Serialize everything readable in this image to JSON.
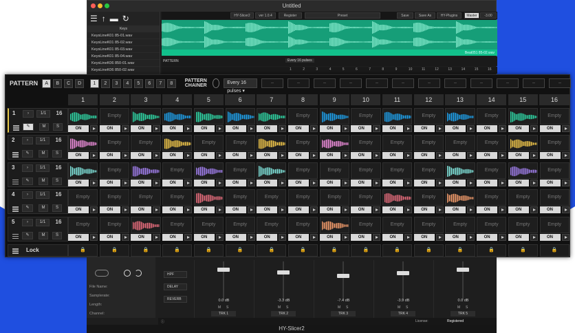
{
  "window": {
    "title": "Untitled",
    "app_name": "HY-Slicer2"
  },
  "topbar": {
    "plugin": "HY-Slicer2",
    "version": "ver 1.0.4",
    "register": "Register",
    "preset": "Preset",
    "save": "Save",
    "save_as": "Save As",
    "plugins": "HY-Plugins",
    "master": "Master",
    "master_db": "-3.00 dB"
  },
  "sidebar": {
    "header": "Keys",
    "files": [
      "KeysLineK01 85-01.wav",
      "KeysLineK01 85-02.wav",
      "KeysLineK01 85-03.wav",
      "KeysLineK01 85-04.wav",
      "KeysLineK06 850-01.wav",
      "KeysLineK06 850-02.wav"
    ]
  },
  "waveform": {
    "file": "Beat051 85-02.wav"
  },
  "back_pattern": {
    "label": "PATTERN",
    "every": "Every 16 pulses"
  },
  "pattern": {
    "title": "PATTERN",
    "banks": [
      "A",
      "B",
      "C",
      "D"
    ],
    "active_bank": "A",
    "numbers": [
      "1",
      "2",
      "3",
      "4",
      "5",
      "6",
      "7",
      "8"
    ],
    "active_number": "1",
    "chainer": "PATTERN CHAINER",
    "pulses": "Every 16 pulses",
    "chain_slots": [
      "--",
      "--",
      "--",
      "--",
      "--",
      "--",
      "--",
      "--",
      "--",
      "--",
      "--",
      "--"
    ]
  },
  "columns": [
    "1",
    "2",
    "3",
    "4",
    "5",
    "6",
    "7",
    "8",
    "9",
    "10",
    "11",
    "12",
    "13",
    "14",
    "15",
    "16"
  ],
  "tracks": [
    {
      "num": "1",
      "rate": "1/1",
      "steps": "16",
      "m": "M",
      "s": "S"
    },
    {
      "num": "2",
      "rate": "1/1",
      "steps": "16",
      "m": "M",
      "s": "S"
    },
    {
      "num": "3",
      "rate": "1/1",
      "steps": "16",
      "m": "M",
      "s": "S"
    },
    {
      "num": "4",
      "rate": "1/1",
      "steps": "16",
      "m": "M",
      "s": "S"
    },
    {
      "num": "5",
      "rate": "1/1",
      "steps": "16",
      "m": "M",
      "s": "S"
    }
  ],
  "grid": [
    [
      "#2fd3a3",
      "",
      "#2fd3a3",
      "#1e9fe8",
      "#2fd3a3",
      "#1e9fe8",
      "#2fd3a3",
      "",
      "#1e9fe8",
      "",
      "#1e9fe8",
      "",
      "#1e9fe8",
      "",
      "#2fd3a3",
      ""
    ],
    [
      "#e88ad6",
      "",
      "",
      "#f0c64a",
      "",
      "",
      "#f0c64a",
      "",
      "#e88ad6",
      "",
      "",
      "",
      "",
      "",
      "#f0c64a",
      ""
    ],
    [
      "#7ee0d8",
      "",
      "#9d7ce8",
      "",
      "#9d7ce8",
      "",
      "#7ee0d8",
      "",
      "",
      "",
      "",
      "",
      "#7ee0d8",
      "",
      "#9d7ce8",
      ""
    ],
    [
      "",
      "",
      "",
      "",
      "#e36b7a",
      "",
      "",
      "",
      "",
      "",
      "#e36b7a",
      "",
      "#f09a6a",
      "",
      "",
      ""
    ],
    [
      "",
      "",
      "#e36b7a",
      "",
      "",
      "",
      "",
      "",
      "#f09a6a",
      "",
      "",
      "",
      "",
      "",
      "",
      ""
    ]
  ],
  "cell_text": {
    "empty": "Empty",
    "on": "ON"
  },
  "lock": {
    "label": "Lock"
  },
  "bottom": {
    "labels": [
      "File Name:",
      "Samplerate:",
      "Length:",
      "Channel:"
    ],
    "fx": [
      "HPF",
      "DELAY",
      "REVERB"
    ],
    "strips": [
      {
        "db": "0.0 dB",
        "name": "TRK 1",
        "level": 0.78
      },
      {
        "db": "-3.3 dB",
        "name": "TRK 2",
        "level": 0.72
      },
      {
        "db": "-7.4 dB",
        "name": "TRK 3",
        "level": 0.62
      },
      {
        "db": "-3.9 dB",
        "name": "TRK 4",
        "level": 0.7
      },
      {
        "db": "0.0 dB",
        "name": "TRK 5",
        "level": 0.78
      }
    ],
    "m": "M",
    "s": "S",
    "license_label": "License:",
    "license": "Registered"
  }
}
